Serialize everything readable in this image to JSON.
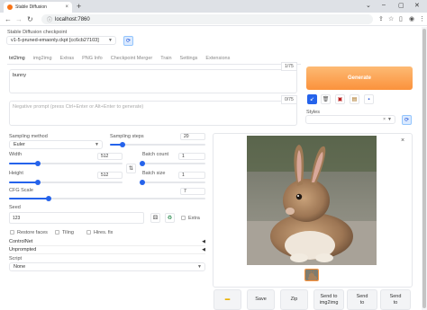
{
  "browser": {
    "tab_title": "Stable Diffusion",
    "url": "localhost:7860"
  },
  "checkpoint": {
    "label": "Stable Diffusion checkpoint",
    "value": "v1-5-pruned-emaonly.ckpt [cc6cb27103]"
  },
  "tabs": [
    "txt2img",
    "img2img",
    "Extras",
    "PNG Info",
    "Checkpoint Merger",
    "Train",
    "Settings",
    "Extensions"
  ],
  "prompt": {
    "value": "bunny",
    "counter": "1/75",
    "negative_placeholder": "Negative prompt (press Ctrl+Enter or Alt+Enter to generate)",
    "negative_counter": "0/75"
  },
  "generate_label": "Generate",
  "styles_label": "Styles",
  "sampling": {
    "method_label": "Sampling method",
    "method_value": "Euler",
    "steps_label": "Sampling steps",
    "steps_value": "20",
    "steps_fraction": 0.13
  },
  "size": {
    "width_label": "Width",
    "width_value": "512",
    "height_label": "Height",
    "height_value": "512",
    "width_fraction": 0.25,
    "height_fraction": 0.25
  },
  "batch": {
    "count_label": "Batch count",
    "count_value": "1",
    "size_label": "Batch size",
    "size_value": "1"
  },
  "cfg": {
    "label": "CFG Scale",
    "value": "7",
    "fraction": 0.2
  },
  "seed": {
    "label": "Seed",
    "value": "123",
    "extra_label": "Extra"
  },
  "options": {
    "restore_faces": "Restore faces",
    "tiling": "Tiling",
    "hires_fix": "Hires. fix"
  },
  "accordions": [
    "ControlNet",
    "Unprompted"
  ],
  "script": {
    "label": "Script",
    "value": "None"
  },
  "output_buttons": [
    {
      "line1": "",
      "line2": ""
    },
    {
      "line1": "Save",
      "line2": ""
    },
    {
      "line1": "Zip",
      "line2": ""
    },
    {
      "line1": "Send to",
      "line2": "img2img"
    },
    {
      "line1": "Send",
      "line2": "to"
    },
    {
      "line1": "Send",
      "line2": "to"
    }
  ],
  "colors": {
    "accent": "#2563eb",
    "generate": "#fb923c"
  }
}
